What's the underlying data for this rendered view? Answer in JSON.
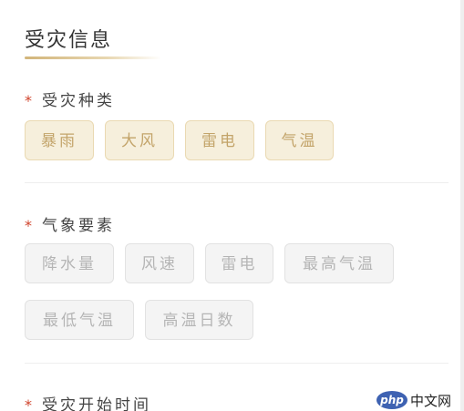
{
  "section": {
    "title": "受灾信息"
  },
  "disaster_type": {
    "required_mark": "*",
    "label": "受灾种类",
    "options": [
      "暴雨",
      "大风",
      "雷电",
      "气温"
    ]
  },
  "weather_elements": {
    "required_mark": "*",
    "label": "气象要素",
    "options": [
      "降水量",
      "风速",
      "雷电",
      "最高气温",
      "最低气温",
      "高温日数"
    ]
  },
  "start_time": {
    "required_mark": "*",
    "label": "受灾开始时间"
  },
  "watermark": {
    "logo": "php",
    "text": "中文网"
  },
  "colors": {
    "accent_gold": "#c3a46a",
    "selected_chip_bg": "#f6efdc",
    "unselected_chip_bg": "#f4f4f4",
    "required_star": "#d0432b"
  }
}
